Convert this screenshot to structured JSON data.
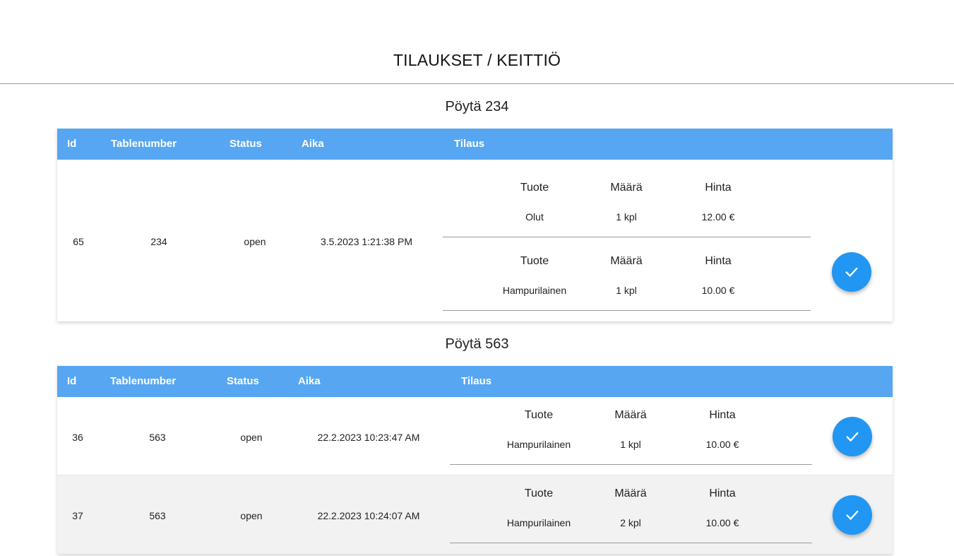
{
  "header": {
    "title": "TILAUKSET / KEITTIÖ"
  },
  "columns": {
    "id": "Id",
    "tablenumber": "Tablenumber",
    "status": "Status",
    "aika": "Aika",
    "tilaus": "Tilaus"
  },
  "item_headers": {
    "tuote": "Tuote",
    "maara": "Määrä",
    "hinta": "Hinta"
  },
  "tables": [
    {
      "title": "Pöytä 234",
      "orders": [
        {
          "id": "65",
          "tablenumber": "234",
          "status": "open",
          "aika": "3.5.2023 1:21:38 PM",
          "items": [
            {
              "tuote": "Olut",
              "maara": "1 kpl",
              "hinta": "12.00 €"
            },
            {
              "tuote": "Hampurilainen",
              "maara": "1 kpl",
              "hinta": "10.00 €"
            }
          ]
        }
      ]
    },
    {
      "title": "Pöytä 563",
      "orders": [
        {
          "id": "36",
          "tablenumber": "563",
          "status": "open",
          "aika": "22.2.2023 10:23:47 AM",
          "items": [
            {
              "tuote": "Hampurilainen",
              "maara": "1 kpl",
              "hinta": "10.00 €"
            }
          ]
        },
        {
          "id": "37",
          "tablenumber": "563",
          "status": "open",
          "aika": "22.2.2023 10:24:07 AM",
          "items": [
            {
              "tuote": "Hampurilainen",
              "maara": "2 kpl",
              "hinta": "10.00 €"
            }
          ]
        }
      ]
    }
  ],
  "colors": {
    "header_bar": "#56a6f2",
    "fab": "#2196f3",
    "alt_row": "#f2f2f2"
  },
  "icons": {
    "complete": "check-icon"
  }
}
